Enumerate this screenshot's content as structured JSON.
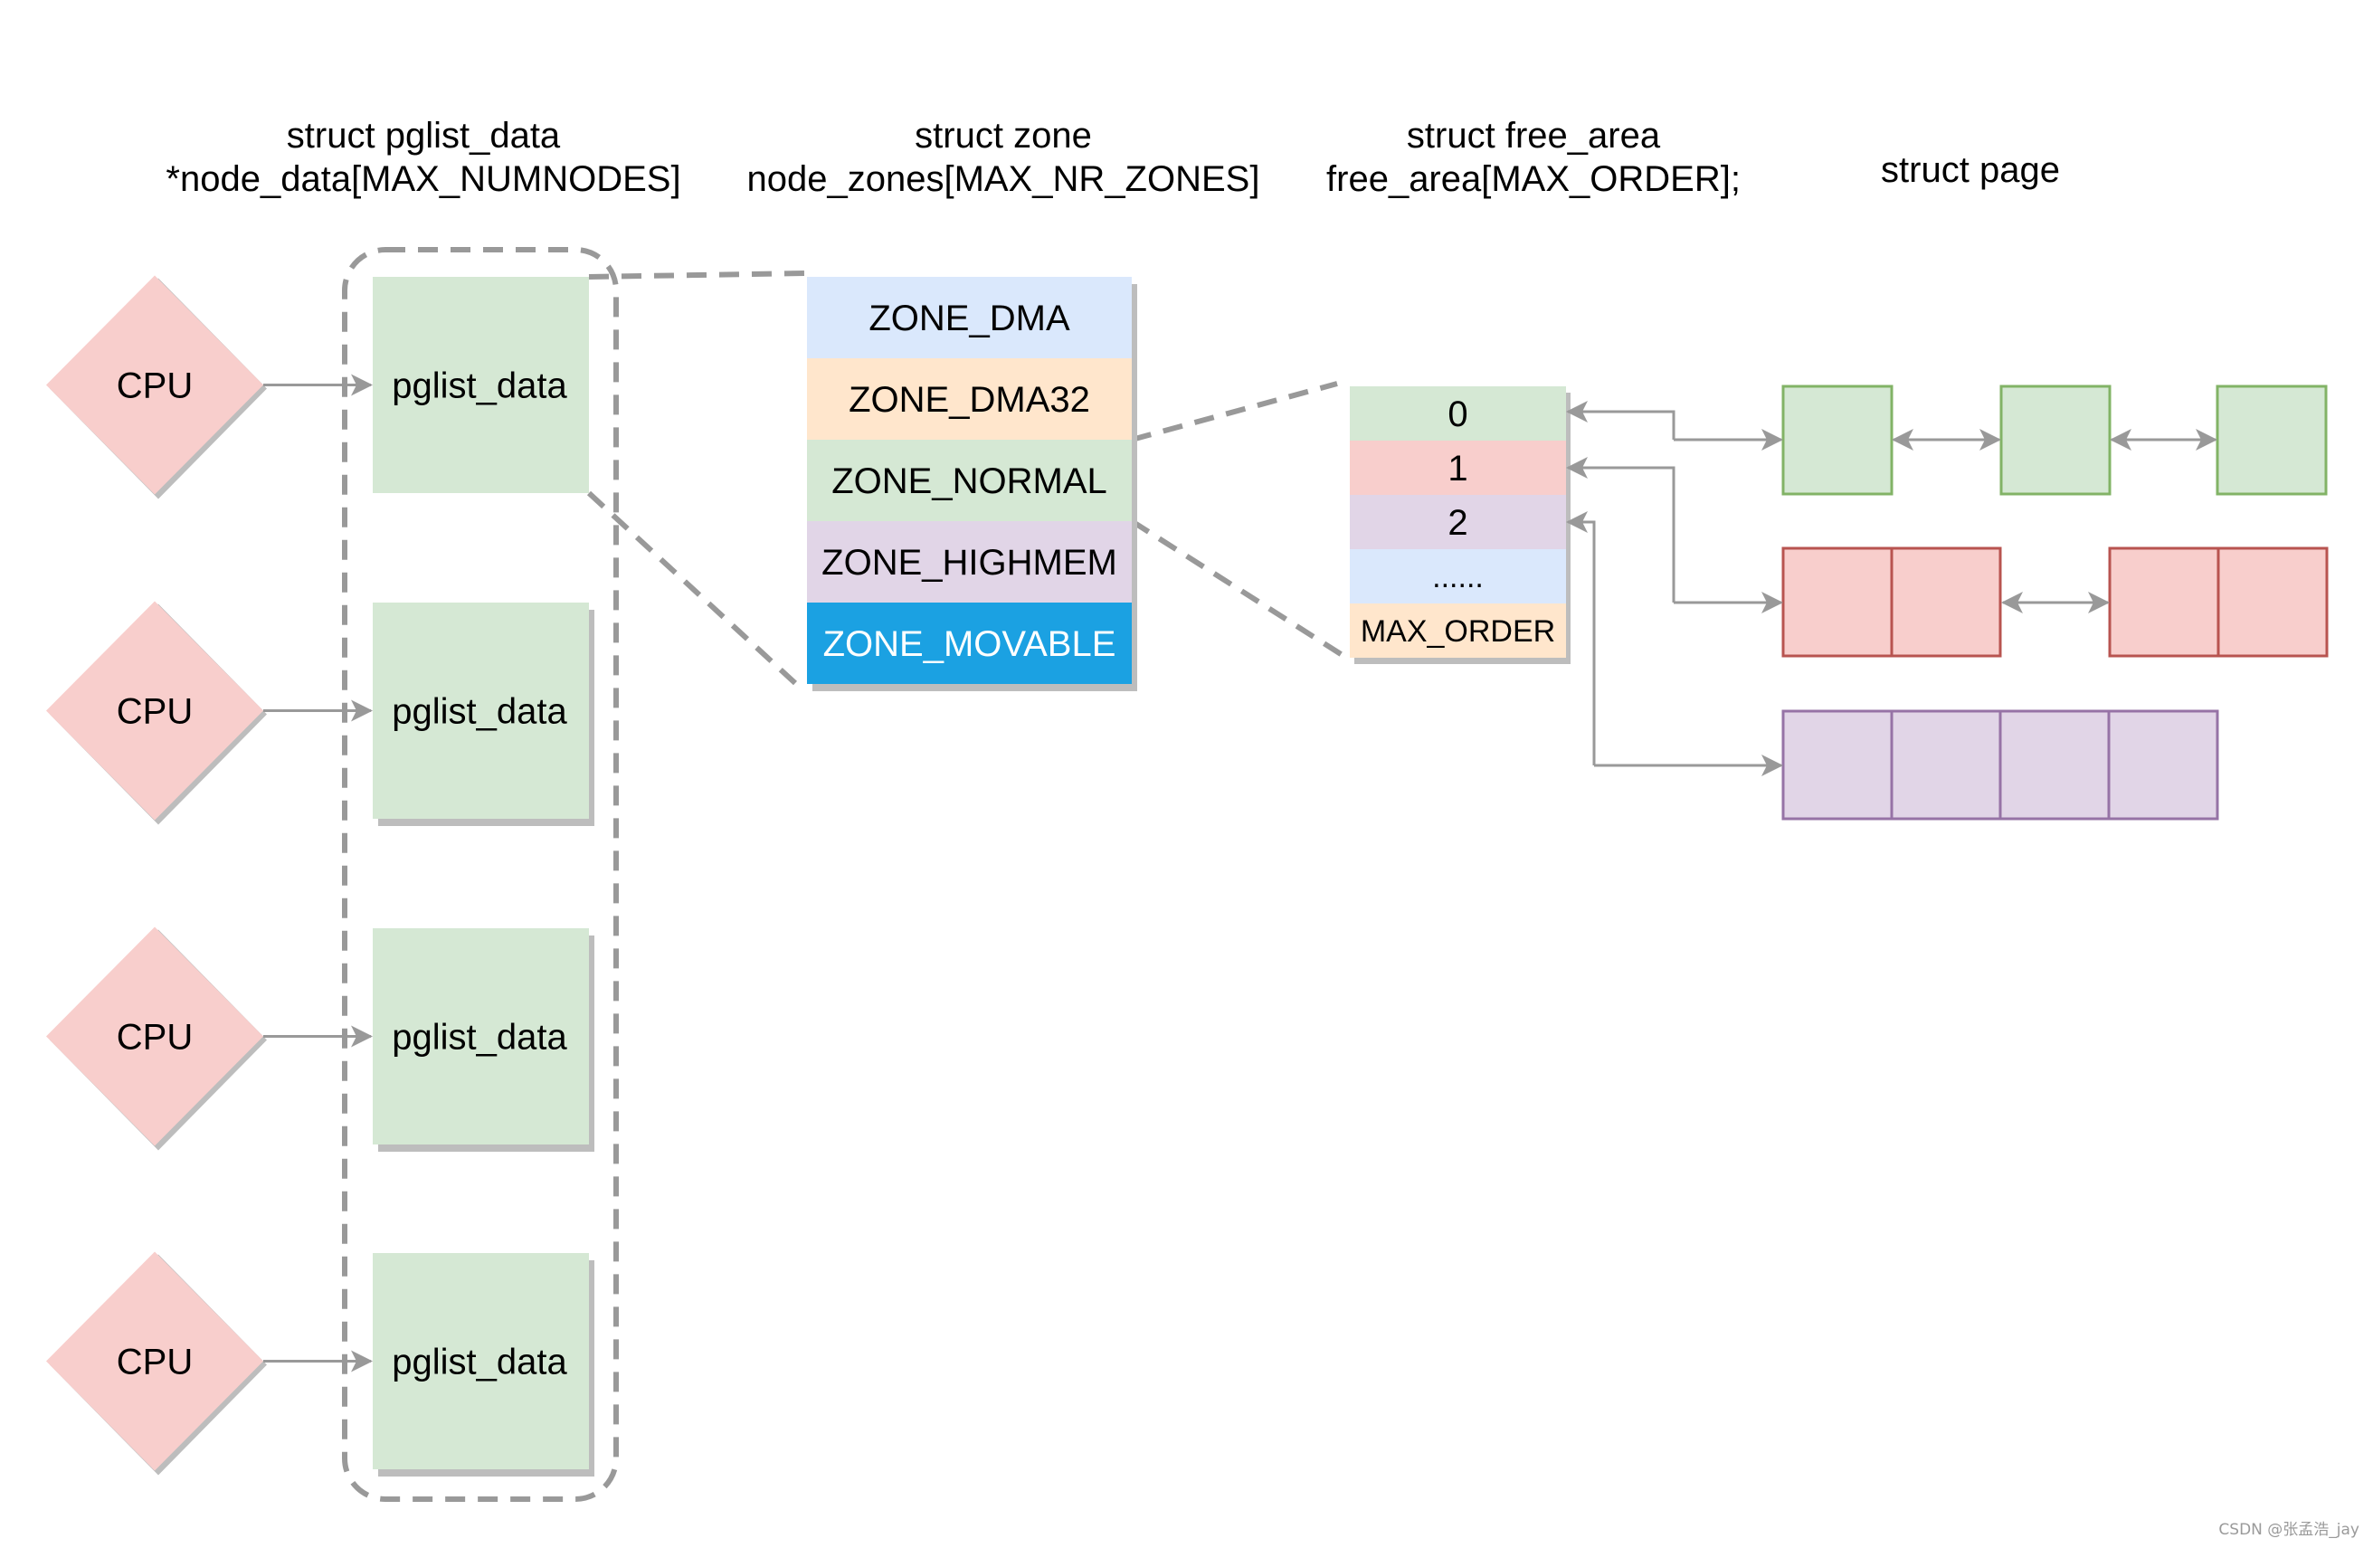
{
  "titles": {
    "pglist": [
      "struct pglist_data",
      "*node_data[MAX_NUMNODES]"
    ],
    "zone": [
      "struct zone",
      "node_zones[MAX_NR_ZONES]"
    ],
    "free_area": [
      "struct free_area",
      "free_area[MAX_ORDER];"
    ],
    "page": "struct page"
  },
  "nodes": [
    {
      "cpu_label": "CPU",
      "pglist_label": "pglist_data"
    },
    {
      "cpu_label": "CPU",
      "pglist_label": "pglist_data"
    },
    {
      "cpu_label": "CPU",
      "pglist_label": "pglist_data"
    },
    {
      "cpu_label": "CPU",
      "pglist_label": "pglist_data"
    }
  ],
  "zones": [
    {
      "label": "ZONE_DMA",
      "color": "#dae8fc",
      "text_color": "#000000"
    },
    {
      "label": "ZONE_DMA32",
      "color": "#ffe6cc",
      "text_color": "#000000"
    },
    {
      "label": "ZONE_NORMAL",
      "color": "#d5e8d4",
      "text_color": "#000000"
    },
    {
      "label": "ZONE_HIGHMEM",
      "color": "#e1d5e7",
      "text_color": "#000000"
    },
    {
      "label": "ZONE_MOVABLE",
      "color": "#1ba1e2",
      "text_color": "#ffffff"
    }
  ],
  "free_area": [
    {
      "label": "0",
      "color": "#d5e8d4"
    },
    {
      "label": "1",
      "color": "#f8cecc"
    },
    {
      "label": "2",
      "color": "#e1d5e7"
    },
    {
      "label": "......",
      "color": "#dae8fc"
    },
    {
      "label": "MAX_ORDER",
      "color": "#ffe6cc"
    }
  ],
  "page_lists": [
    {
      "order": 0,
      "fill": "#d5e8d4",
      "stroke": "#82b366",
      "blocks": 3,
      "pages_per_block": 1
    },
    {
      "order": 1,
      "fill": "#f8cecc",
      "stroke": "#b85450",
      "blocks": 2,
      "pages_per_block": 2
    },
    {
      "order": 2,
      "fill": "#e1d5e7",
      "stroke": "#9673a6",
      "blocks": 1,
      "pages_per_block": 4
    }
  ],
  "colors": {
    "cpu": "#f8cecc",
    "pglist": "#d5e8d4",
    "shadow": "#bdbdbd",
    "connector": "#999999",
    "dashed": "#999999"
  },
  "watermark": "CSDN @张孟浩_jay"
}
